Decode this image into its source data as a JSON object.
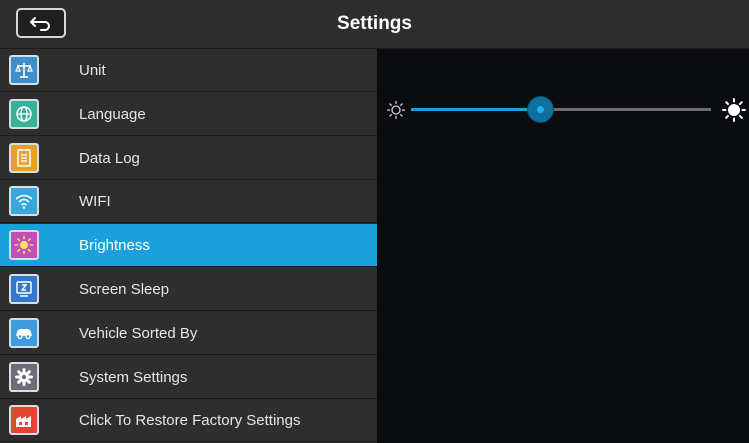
{
  "header": {
    "title": "Settings",
    "back_icon": "back-arrow-icon"
  },
  "sidebar": {
    "items": [
      {
        "label": "Unit",
        "icon": "scale-icon",
        "icon_color": "#3d8ec9"
      },
      {
        "label": "Language",
        "icon": "globe-icon",
        "icon_color": "#38b39a"
      },
      {
        "label": "Data Log",
        "icon": "document-icon",
        "icon_color": "#e8a22a"
      },
      {
        "label": "WIFI",
        "icon": "wifi-icon",
        "icon_color": "#3aa7dc"
      },
      {
        "label": "Brightness",
        "icon": "sun-icon",
        "icon_color": "#c04fb8",
        "active": true
      },
      {
        "label": "Screen Sleep",
        "icon": "sleep-icon",
        "icon_color": "#3478c9"
      },
      {
        "label": "Vehicle Sorted By",
        "icon": "car-icon",
        "icon_color": "#3f9ddd"
      },
      {
        "label": "System Settings",
        "icon": "gear-icon",
        "icon_color": "#6a6e74"
      },
      {
        "label": "Click To Restore Factory Settings",
        "icon": "factory-reset-icon",
        "icon_color": "#e0452f"
      }
    ]
  },
  "brightness": {
    "value": 0.43,
    "min_icon": "sun-outline-icon",
    "max_icon": "sun-filled-icon"
  },
  "colors": {
    "accent": "#1ba0dc",
    "sidebar_bg": "#2e2e2e",
    "header_bg": "#2d2d2d",
    "content_bg": "#0a0c0f"
  }
}
